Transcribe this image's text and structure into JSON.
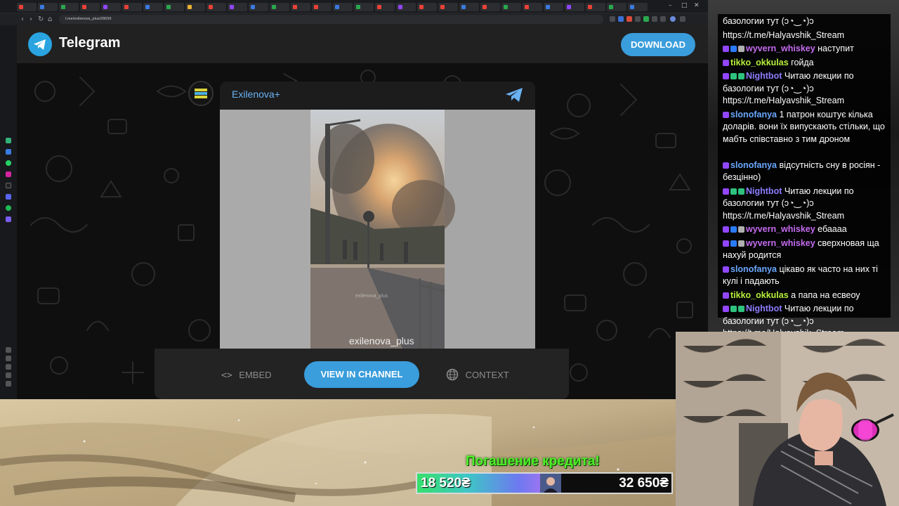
{
  "browser": {
    "url": "t.me/exilenova_plus/28659",
    "back_icon": "arrow-left-icon",
    "forward_icon": "arrow-right-icon",
    "reload_icon": "reload-icon"
  },
  "telegram": {
    "brand": "Telegram",
    "download_label": "DOWNLOAD",
    "channel_name": "Exilenova+",
    "watermark_main": "exilenova_plus",
    "watermark_small": "exilenova_plus",
    "embed_label": "EMBED",
    "view_label": "VIEW IN CHANNEL",
    "context_label": "CONTEXT",
    "accent": "#3a9ddc",
    "channel_color": "#6ab2f2"
  },
  "chat": {
    "lines": [
      {
        "user": "",
        "text": "базологии тут (ↄ◔‿◔)ↄ"
      },
      {
        "user": "",
        "text": "https://t.me/Halyavshik_Stream"
      },
      {
        "user": "wyvern_whiskey",
        "text": "наступит",
        "color": "#c56cf0",
        "badges": [
          "#9146ff",
          "#2a7bff",
          "#b0b0b0"
        ]
      },
      {
        "user": "tikko_okkulas",
        "text": "гойда",
        "color": "#b5f03a",
        "badges": [
          "#9146ff"
        ]
      },
      {
        "user": "Nightbot",
        "text": "Читаю лекции по базологии тут (ↄ◔‿◔)ↄ https://t.me/Halyavshik_Stream",
        "color": "#8c7cff",
        "badges": [
          "#9146ff",
          "#2ec27e",
          "#2ec27e"
        ]
      },
      {
        "user": "slonofanya",
        "text": "1 патрон коштує кілька доларів. вони їх випускають стільки, що мабть співставно з тим дроном",
        "color": "#6aa8ff",
        "badges": [
          "#9146ff"
        ]
      },
      {
        "user": "slonofanya",
        "text": "відсутність сну в росіян - безцінно)",
        "color": "#6aa8ff",
        "badges": [
          "#9146ff"
        ]
      },
      {
        "user": "Nightbot",
        "text": "Читаю лекции по базологии тут (ↄ◔‿◔)ↄ https://t.me/Halyavshik_Stream",
        "color": "#8c7cff",
        "badges": [
          "#9146ff",
          "#2ec27e",
          "#2ec27e"
        ]
      },
      {
        "user": "wyvern_whiskey",
        "text": "ебаааа",
        "color": "#c56cf0",
        "badges": [
          "#9146ff",
          "#2a7bff",
          "#b0b0b0"
        ]
      },
      {
        "user": "wyvern_whiskey",
        "text": "сверхновая ща нахуй родится",
        "color": "#c56cf0",
        "badges": [
          "#9146ff",
          "#2a7bff",
          "#b0b0b0"
        ]
      },
      {
        "user": "slonofanya",
        "text": "цікаво як часто на них ті кулі і падають",
        "color": "#6aa8ff",
        "badges": [
          "#9146ff"
        ]
      },
      {
        "user": "tikko_okkulas",
        "text": "а папа на есвеоу",
        "color": "#b5f03a",
        "badges": [
          "#9146ff"
        ]
      },
      {
        "user": "Nightbot",
        "text": "Читаю лекции по базологии тут (ↄ◔‿◔)ↄ https://t.me/Halyavshik_Stream",
        "color": "#8c7cff",
        "badges": [
          "#9146ff",
          "#2ec27e",
          "#2ec27e"
        ]
      }
    ]
  },
  "credit": {
    "title": "Погашение кредита!",
    "current": "18 520₴",
    "goal": "32 650₴",
    "progress": 0.567
  }
}
